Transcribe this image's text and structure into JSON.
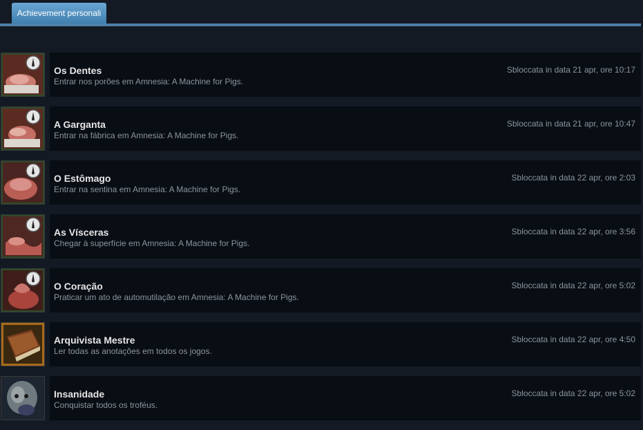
{
  "tab": {
    "label": "Achievement personali"
  },
  "achievements": [
    {
      "title": "Os Dentes",
      "description": "Entrar nos porões em Amnesia: A Machine for Pigs.",
      "unlocked": "Sbloccata in data 21 apr, ore 10:17",
      "icon": "meat-hook-icon"
    },
    {
      "title": "A Garganta",
      "description": "Entrar na fábrica em Amnesia: A Machine for Pigs.",
      "unlocked": "Sbloccata in data 21 apr, ore 10:47",
      "icon": "meat-hook-icon"
    },
    {
      "title": "O Estômago",
      "description": "Entrar na sentina em Amnesia: A Machine for Pigs.",
      "unlocked": "Sbloccata in data 22 apr, ore 2:03",
      "icon": "meat-hook-icon"
    },
    {
      "title": "As Vísceras",
      "description": "Chegar à superfície em Amnesia: A Machine for Pigs.",
      "unlocked": "Sbloccata in data 22 apr, ore 3:56",
      "icon": "meat-hook-icon"
    },
    {
      "title": "O Coração",
      "description": "Praticar um ato de automutilação em Amnesia: A Machine for Pigs.",
      "unlocked": "Sbloccata in data 22 apr, ore 5:02",
      "icon": "meat-hook-icon"
    },
    {
      "title": "Arquivista Mestre",
      "description": "Ler todas as anotações em todos os jogos.",
      "unlocked": "Sbloccata in data 22 apr, ore 4:50",
      "icon": "book-icon"
    },
    {
      "title": "Insanidade",
      "description": "Conquistar todos os troféus.",
      "unlocked": "Sbloccata in data 22 apr, ore 5:02",
      "icon": "monster-icon"
    }
  ]
}
